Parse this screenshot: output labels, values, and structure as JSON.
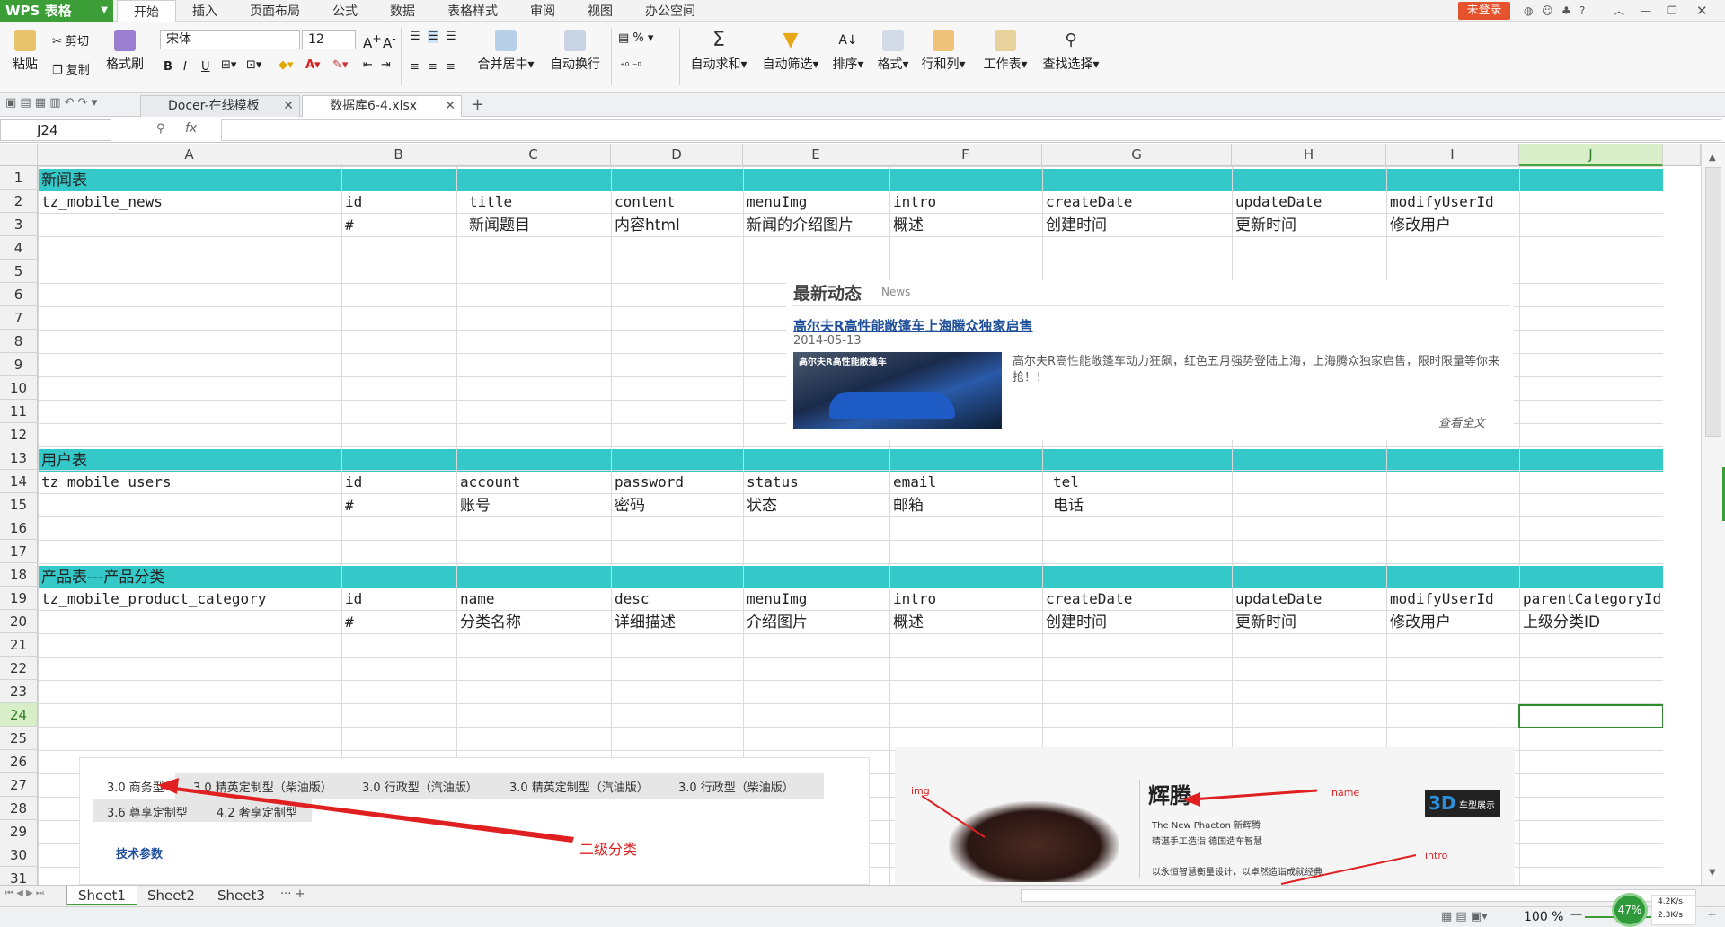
{
  "app": {
    "logo": "WPS 表格",
    "login": "未登录"
  },
  "menu": [
    "开始",
    "插入",
    "页面布局",
    "公式",
    "数据",
    "表格样式",
    "审阅",
    "视图",
    "办公空间"
  ],
  "ribbon": {
    "paste": "粘贴",
    "cut": "剪切",
    "copy": "复制",
    "format_painter": "格式刷",
    "font": "宋体",
    "size": "12",
    "merge": "合并居中",
    "wrap": "自动换行",
    "autosum": "自动求和",
    "filter": "自动筛选",
    "sort": "排序",
    "format": "格式",
    "rowcol": "行和列",
    "sheet": "工作表",
    "find": "查找选择",
    "pct": "%"
  },
  "tabs": [
    {
      "label": "Docer-在线模板"
    },
    {
      "label": "数据库6-4.xlsx"
    }
  ],
  "formula": {
    "namebox": "J24",
    "fx": "fx",
    "value": ""
  },
  "columns": [
    "A",
    "B",
    "C",
    "D",
    "E",
    "F",
    "G",
    "H",
    "I",
    "J"
  ],
  "rows": [
    "1",
    "2",
    "3",
    "4",
    "5",
    "6",
    "7",
    "8",
    "9",
    "10",
    "11",
    "12",
    "13",
    "14",
    "15",
    "16",
    "17",
    "18",
    "19",
    "20",
    "21",
    "22",
    "23",
    "24",
    "25",
    "26",
    "27",
    "28",
    "29",
    "30",
    "31"
  ],
  "cells": {
    "r1a": "新闻表",
    "r2": [
      "tz_mobile_news",
      "id",
      "title",
      "content",
      "menuImg",
      "intro",
      "createDate",
      "updateDate",
      "modifyUserId"
    ],
    "r3": [
      "",
      "#",
      "新闻题目",
      "内容html",
      "新闻的介绍图片",
      "概述",
      "创建时间",
      "更新时间",
      "修改用户"
    ],
    "r13a": "用户表",
    "r14": [
      "tz_mobile_users",
      "id",
      "account",
      "password",
      "status",
      "email",
      "tel"
    ],
    "r15": [
      "",
      "#",
      "账号",
      "密码",
      "状态",
      "邮箱",
      "电话"
    ],
    "r18a": "产品表---产品分类",
    "r19": [
      "tz_mobile_product_category",
      "id",
      "name",
      "desc",
      "menuImg",
      "intro",
      "createDate",
      "updateDate",
      "modifyUserId",
      "parentCategoryId"
    ],
    "r20": [
      "",
      "#",
      "分类名称",
      "详细描述",
      "介绍图片",
      "概述",
      "创建时间",
      "更新时间",
      "修改用户",
      "上级分类ID"
    ]
  },
  "news_image": {
    "heading": "最新动态",
    "heading_en": "News",
    "title": "高尔夫R高性能敞篷车上海腾众独家启售",
    "date": "2014-05-13",
    "thumb_caption": "高尔夫R高性能敞篷车",
    "desc": "高尔夫R高性能敞篷车动力狂飙，红色五月强势登陆上海，上海腾众独家启售，限时限量等你来抢！！",
    "more": "查看全文"
  },
  "product_image": {
    "tabs_row1": [
      "3.0 商务型",
      "3.0 精英定制型（柴油版）",
      "3.0 行政型（汽油版）",
      "3.0 精英定制型（汽油版）",
      "3.0 行政型（柴油版）"
    ],
    "tabs_row2": [
      "3.6 尊享定制型",
      "4.2 奢享定制型"
    ],
    "link": "技术参数",
    "annotation": "二级分类"
  },
  "car_image": {
    "img_label": "img",
    "name_label": "name",
    "intro_label": "intro",
    "brand": "辉腾",
    "line1": "The New Phaeton 新辉腾",
    "line2": "精湛手工造诣 德国造车智慧",
    "line3": "以永恒智慧衡量设计，以卓然造诣成就经典",
    "badge": "车型展示",
    "badge3d": "3D"
  },
  "sheets": [
    "Sheet1",
    "Sheet2",
    "Sheet3"
  ],
  "status": {
    "zoom": "100 %",
    "progress": "47%",
    "up": "4.2K/s",
    "down": "2.3K/s"
  }
}
